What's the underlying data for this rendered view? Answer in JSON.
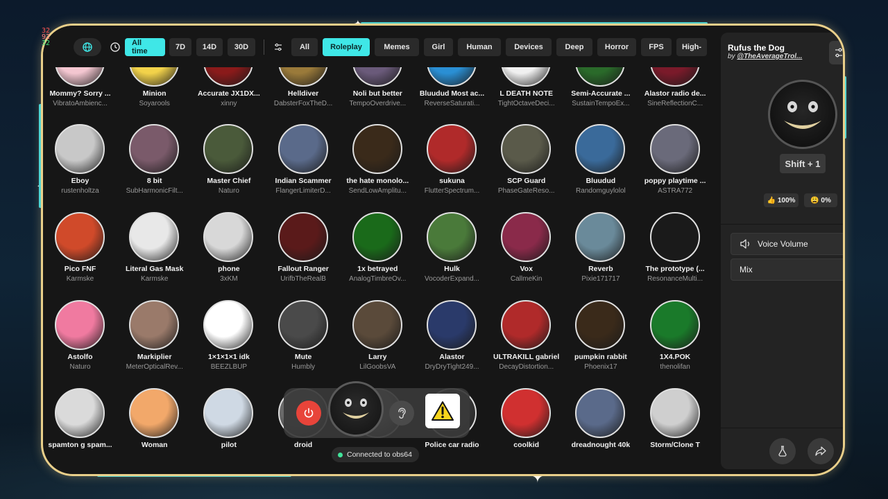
{
  "fps_overlay": {
    "line1": "32",
    "line2": "92",
    "line3": "32"
  },
  "toolbar": {
    "time_filters": [
      {
        "label": "All time",
        "active": true
      },
      {
        "label": "7D",
        "active": false
      },
      {
        "label": "14D",
        "active": false
      },
      {
        "label": "30D",
        "active": false
      }
    ],
    "categories": [
      {
        "label": "All",
        "active": false
      },
      {
        "label": "Roleplay",
        "active": true
      },
      {
        "label": "Memes",
        "active": false
      },
      {
        "label": "Girl",
        "active": false
      },
      {
        "label": "Human",
        "active": false
      },
      {
        "label": "Devices",
        "active": false
      },
      {
        "label": "Deep",
        "active": false
      },
      {
        "label": "Horror",
        "active": false
      },
      {
        "label": "FPS",
        "active": false
      },
      {
        "label": "High-",
        "active": false
      }
    ],
    "accent_color": "#3fe7e7"
  },
  "voices": [
    {
      "name": "Mommy? Sorry ...",
      "author": "VibratoAmbienc..."
    },
    {
      "name": "Minion",
      "author": "Soyarools"
    },
    {
      "name": "Accurate JX1DX...",
      "author": "xinny"
    },
    {
      "name": "Helldiver",
      "author": "DabsterFoxTheD..."
    },
    {
      "name": "Noli but better",
      "author": "TempoOverdrive..."
    },
    {
      "name": "Bluudud Most ac...",
      "author": "ReverseSaturati..."
    },
    {
      "name": "L DEATH NOTE",
      "author": "TightOctaveDeci..."
    },
    {
      "name": "Semi-Accurate ...",
      "author": "SustainTempoEx..."
    },
    {
      "name": "Alastor radio de...",
      "author": "SineReflectionC..."
    },
    {
      "name": "Eboy",
      "author": "rustenholtza"
    },
    {
      "name": "8 bit",
      "author": "SubHarmonicFilt..."
    },
    {
      "name": "Master Chief",
      "author": "Naturo"
    },
    {
      "name": "Indian Scammer",
      "author": "FlangerLimiterD..."
    },
    {
      "name": "the hate monolo...",
      "author": "SendLowAmplitu..."
    },
    {
      "name": "sukuna",
      "author": "FlutterSpectrum..."
    },
    {
      "name": "SCP Guard",
      "author": "PhaseGateReso..."
    },
    {
      "name": "Bluudud",
      "author": "Randomguylolol"
    },
    {
      "name": "poppy playtime ...",
      "author": "ASTRA772"
    },
    {
      "name": "Pico FNF",
      "author": "Karmske"
    },
    {
      "name": "Literal Gas Mask",
      "author": "Karmske"
    },
    {
      "name": "phone",
      "author": "3xKM"
    },
    {
      "name": "Fallout Ranger",
      "author": "UrifbTheRealB"
    },
    {
      "name": "1x betrayed",
      "author": "AnalogTimbreOv..."
    },
    {
      "name": "Hulk",
      "author": "VocoderExpand..."
    },
    {
      "name": "Vox",
      "author": "CallmeKin"
    },
    {
      "name": "Reverb",
      "author": "Pixie171717"
    },
    {
      "name": "The prototype (...",
      "author": "ResonanceMulti..."
    },
    {
      "name": "Astolfo",
      "author": "Naturo"
    },
    {
      "name": "Markiplier",
      "author": "MeterOpticalRev..."
    },
    {
      "name": "1×1×1×1 idk",
      "author": "BEEZLBUP"
    },
    {
      "name": "Mute",
      "author": "Humbly"
    },
    {
      "name": "Larry",
      "author": "LilGoobsVA"
    },
    {
      "name": "Alastor",
      "author": "DryDryTight249..."
    },
    {
      "name": "ULTRAKILL gabriel",
      "author": "DecayDistortion..."
    },
    {
      "name": "pumpkin rabbit",
      "author": "Phoenix17"
    },
    {
      "name": "1X4.POK",
      "author": "thenolifan"
    },
    {
      "name": "spamton g spam...",
      "author": ""
    },
    {
      "name": "Woman",
      "author": ""
    },
    {
      "name": "pilot",
      "author": ""
    },
    {
      "name": "droid",
      "author": ""
    },
    {
      "name": "",
      "author": ""
    },
    {
      "name": "Police car radio",
      "author": ""
    },
    {
      "name": "coolkid",
      "author": ""
    },
    {
      "name": "dreadnought 40k",
      "author": ""
    },
    {
      "name": "Storm/Clone T",
      "author": ""
    }
  ],
  "avatar_colors": [
    "#f3c6d0",
    "#f2d24a",
    "#8a1a1a",
    "#9a7a3a",
    "#6a5a7a",
    "#2a8fd4",
    "#f0f0f0",
    "#2a6a2a",
    "#7a1a2a",
    "#c8c8c8",
    "#7a5a6a",
    "#4a5a3a",
    "#5a6a8a",
    "#3a2a1a",
    "#b02a2a",
    "#5a5a4a",
    "#3a6a9a",
    "#6a6a7a",
    "#d04a2a",
    "#e8e8e8",
    "#d8d8d8",
    "#5a1a1a",
    "#1a6a1a",
    "#4a7a3a",
    "#8a2a4a",
    "#6a8a9a",
    "#1a1a1a",
    "#f07aa0",
    "#9a7a6a",
    "#ffffff",
    "#4a4a4a",
    "#5a4a3a",
    "#2a3a6a",
    "#b02a2a",
    "#3a2a1a",
    "#1a7a2a",
    "#dadada",
    "#f2a86a",
    "#cfd9e4",
    "#6a6a6a",
    "#888888",
    "#3a3a3a",
    "#d03030",
    "#5a6a8a",
    "#cfcfcf"
  ],
  "control_bar": {
    "status_text": "Connected to obs64"
  },
  "panel": {
    "title": "Rufus the Dog",
    "by_prefix": "by ",
    "author": "@TheAverageTrol...",
    "keybind": "Shift + 1",
    "like": "👍 100%",
    "dislike": "😩 0%",
    "voice_volume_label": "Voice Volume",
    "mix_label": "Mix"
  }
}
